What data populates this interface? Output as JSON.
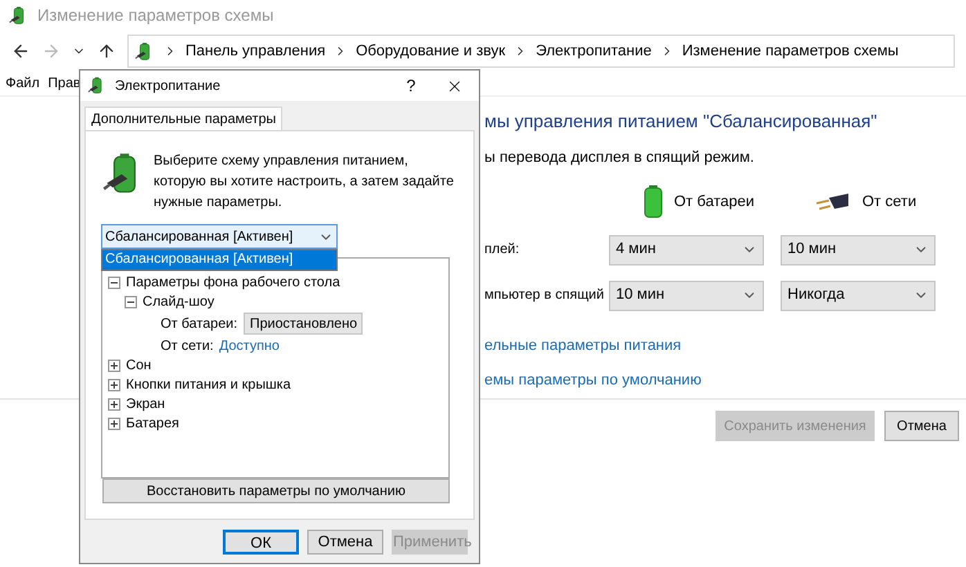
{
  "window": {
    "title": "Изменение параметров схемы"
  },
  "address_bar": {
    "crumbs": [
      "Панель управления",
      "Оборудование и звук",
      "Электропитание",
      "Изменение параметров схемы"
    ]
  },
  "menu": [
    "Файл",
    "Прав"
  ],
  "main": {
    "heading": "мы управления питанием \"Сбалансированная\"",
    "subtitle": "ы перевода дисплея в спящий режим.",
    "columns": [
      {
        "kind": "battery",
        "label": "От батареи"
      },
      {
        "kind": "plug",
        "label": "От сети"
      }
    ],
    "rows": [
      {
        "label": "плей:",
        "values": [
          "4 мин",
          "10 мин"
        ]
      },
      {
        "label": "мпьютер в спящий",
        "values": [
          "10 мин",
          "Никогда"
        ]
      }
    ],
    "links": [
      "ельные параметры питания",
      "емы параметры по умолчанию"
    ],
    "buttons": [
      {
        "label": "Сохранить изменения",
        "disabled": true
      },
      {
        "label": "Отмена",
        "disabled": false
      }
    ]
  },
  "dialog": {
    "title": "Электропитание",
    "help": "?",
    "tab": {
      "label": "Дополнительные параметры",
      "selected": true
    },
    "description": "Выберите схему управления питанием, которую вы хотите настроить, а затем задайте нужные параметры.",
    "scheme": {
      "value": "Сбалансированная [Активен]",
      "open": true,
      "options": [
        {
          "label": "Сбалансированная [Активен]",
          "selected": true
        }
      ]
    },
    "tree": [
      {
        "kind": "node",
        "label": "Параметры фона рабочего стола",
        "expanded": true,
        "children": [
          {
            "kind": "node",
            "label": "Слайд-шоу",
            "expanded": true,
            "children": [
              {
                "kind": "select",
                "label": "От батареи:",
                "value": "Приостановлено"
              },
              {
                "kind": "link",
                "label": "От сети:",
                "value": "Доступно"
              }
            ]
          }
        ]
      },
      {
        "kind": "node",
        "label": "Сон",
        "expanded": false
      },
      {
        "kind": "node",
        "label": "Кнопки питания и крышка",
        "expanded": false
      },
      {
        "kind": "node",
        "label": "Экран",
        "expanded": false
      },
      {
        "kind": "node",
        "label": "Батарея",
        "expanded": false
      }
    ],
    "restore_button": "Восстановить параметры по умолчанию",
    "buttons": [
      {
        "label": "ОК",
        "disabled": false,
        "focused": true
      },
      {
        "label": "Отмена",
        "disabled": false,
        "focused": false
      },
      {
        "label": "Применить",
        "disabled": true,
        "focused": false
      }
    ]
  }
}
